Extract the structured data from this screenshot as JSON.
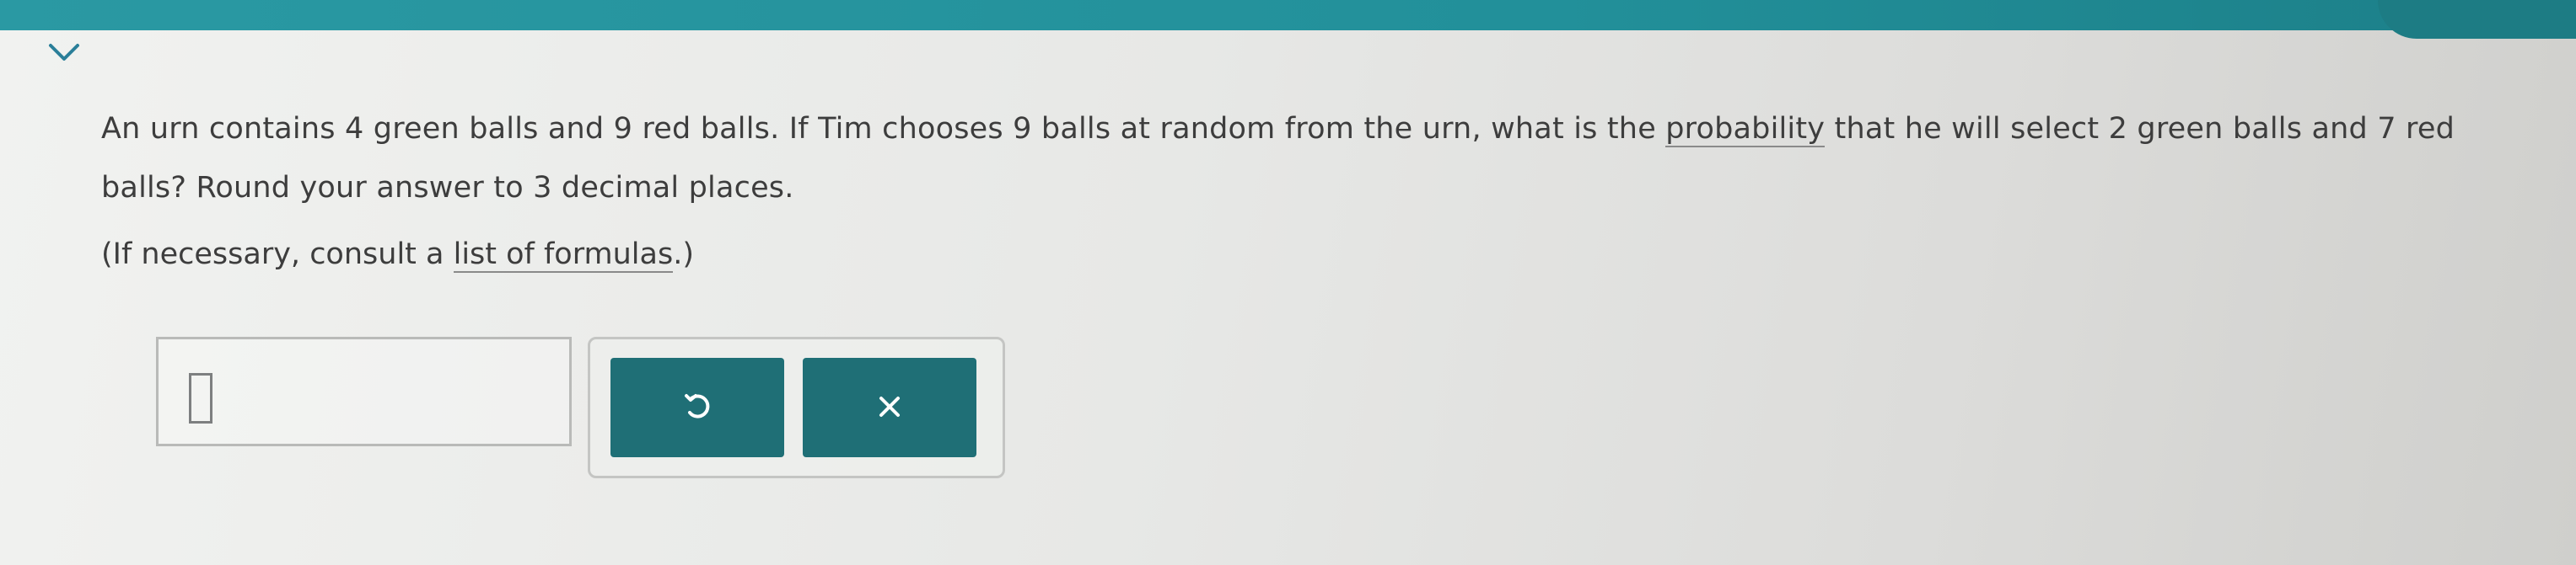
{
  "header": {
    "collapse_icon": "chevron-down-icon"
  },
  "question": {
    "text_before_link": "An urn contains 4 green balls and 9 red balls. If Tim chooses 9 balls at random from the urn, what is the ",
    "link_text": "probability",
    "text_after_link": " that he will select 2 green balls and 7 red balls? Round your answer to 3 decimal places.",
    "formula_prefix": "(If necessary, consult a ",
    "formula_link": "list of formulas",
    "formula_suffix": ".)"
  },
  "answer": {
    "value": ""
  },
  "actions": {
    "undo_icon": "undo-icon",
    "clear_icon": "close-icon"
  },
  "colors": {
    "top_bar": "#2a99a3",
    "button": "#1f6f76",
    "text": "#3d3d3d"
  }
}
